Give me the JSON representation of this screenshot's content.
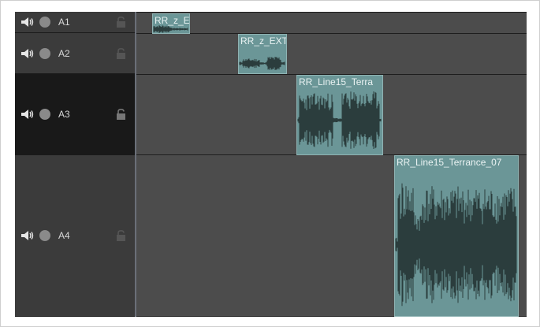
{
  "tracks": [
    {
      "label": "A1",
      "speaker_icon": "speaker-icon",
      "mute_icon": "record-dot-icon",
      "lock_icon": "unlock-icon"
    },
    {
      "label": "A2",
      "speaker_icon": "speaker-icon",
      "mute_icon": "record-dot-icon",
      "lock_icon": "unlock-icon"
    },
    {
      "label": "A3",
      "speaker_icon": "speaker-icon",
      "mute_icon": "record-dot-icon",
      "lock_icon": "unlock-icon"
    },
    {
      "label": "A4",
      "speaker_icon": "speaker-icon",
      "mute_icon": "record-dot-icon",
      "lock_icon": "unlock-icon"
    }
  ],
  "clips": [
    {
      "track": "A1",
      "name": "RR_z_E"
    },
    {
      "track": "A2",
      "name": "RR_z_EXT"
    },
    {
      "track": "A3",
      "name": "RR_Line15_Terra"
    },
    {
      "track": "A4",
      "name": "RR_Line15_Terrance_07"
    }
  ],
  "colors": {
    "clip_fill": "#6b9697",
    "waveform": "#2b3d3d",
    "selected_header": "#191919",
    "lane_bg": "#4c4c4c"
  }
}
